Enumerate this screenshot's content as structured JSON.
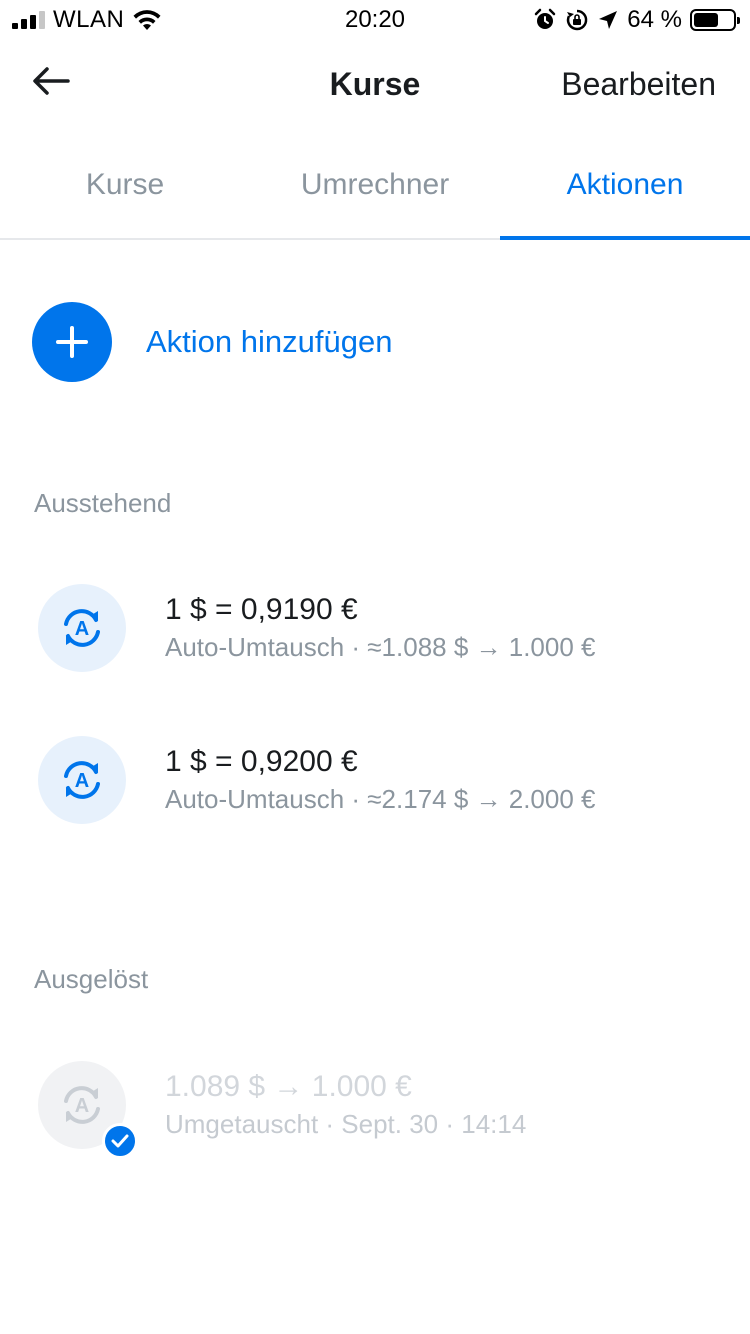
{
  "status_bar": {
    "carrier": "WLAN",
    "time": "20:20",
    "battery_percent": "64 %",
    "battery_level": 0.64
  },
  "header": {
    "title": "Kurse",
    "action_label": "Bearbeiten"
  },
  "tabs": [
    {
      "label": "Kurse",
      "active": false
    },
    {
      "label": "Umrechner",
      "active": false
    },
    {
      "label": "Aktionen",
      "active": true
    }
  ],
  "add_action": {
    "label": "Aktion hinzufügen"
  },
  "pending": {
    "title": "Ausstehend",
    "items": [
      {
        "title": "1 $ = 0,9190 €",
        "subtitle": "Auto-Umtausch · ≈1.088 $ → 1.000 €",
        "icon": "auto-exchange-icon"
      },
      {
        "title": "1 $ = 0,9200 €",
        "subtitle": "Auto-Umtausch · ≈2.174 $ → 2.000 €",
        "icon": "auto-exchange-icon"
      }
    ]
  },
  "triggered": {
    "title": "Ausgelöst",
    "items": [
      {
        "title": "1.089 $ → 1.000 €",
        "subtitle": "Umgetauscht · Sept. 30 · 14:14",
        "icon": "auto-exchange-icon",
        "completed": true
      }
    ]
  },
  "colors": {
    "accent": "#0075eb",
    "muted_text": "#8b959e",
    "icon_bg": "#e7f1fc"
  }
}
